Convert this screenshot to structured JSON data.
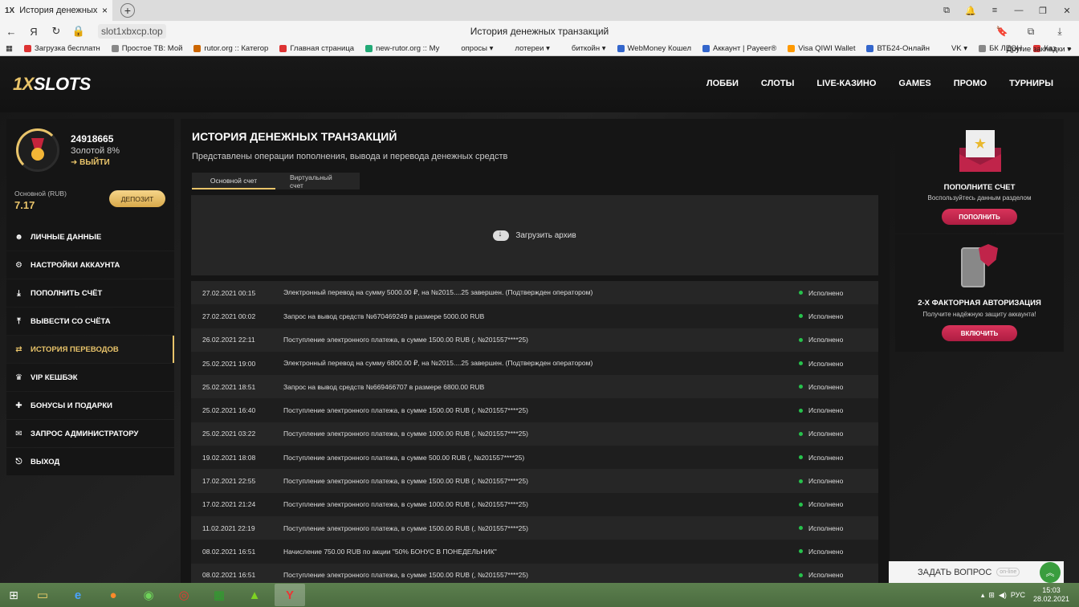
{
  "browser": {
    "tab_title": "История денежных транзакций",
    "tab_favicon": "1X",
    "tab_close": "×",
    "new_tab": "+",
    "url": "slot1xbxcp.top",
    "page_title": "История денежных транзакций",
    "bookmarks": [
      {
        "label": "Загрузка бесплатн",
        "color": "#d33"
      },
      {
        "label": "Простое ТВ: Мой",
        "color": "#888"
      },
      {
        "label": "rutor.org :: Категор",
        "color": "#c60"
      },
      {
        "label": "Главная страница",
        "color": "#d33"
      },
      {
        "label": "new-rutor.org :: Му",
        "color": "#2a7"
      },
      {
        "label": "опросы ▾",
        "color": "#f4f4f4"
      },
      {
        "label": "лотереи ▾",
        "color": "#f4f4f4"
      },
      {
        "label": "биткойн ▾",
        "color": "#f4f4f4"
      },
      {
        "label": "WebMoney Кошел",
        "color": "#36c"
      },
      {
        "label": "Аккаунт | Payeer®",
        "color": "#36c"
      },
      {
        "label": "Visa QIWI Wallet",
        "color": "#f90"
      },
      {
        "label": "ВТБ24-Онлайн",
        "color": "#36c"
      },
      {
        "label": "VK ▾",
        "color": "#f4f4f4"
      },
      {
        "label": "БК ЛЕОН",
        "color": "#888"
      },
      {
        "label": "Каз",
        "color": "#d33"
      }
    ],
    "bookmarks_more": "»",
    "other_bookmarks": "Другие закладки ▾"
  },
  "header": {
    "logo_one": "1X",
    "logo_rest": "SLOTS",
    "menu": [
      "ЛОББИ",
      "СЛОТЫ",
      "LIVE-КАЗИНО",
      "GAMES",
      "ПРОМО",
      "ТУРНИРЫ"
    ]
  },
  "profile": {
    "user_id": "24918665",
    "status": "Золотой 8%",
    "logout": "➜ ВЫЙТИ",
    "account_label": "Основной (RUB)",
    "balance": "7.17",
    "deposit_button": "ДЕПОЗИТ"
  },
  "sidebar": {
    "items": [
      {
        "label": "ЛИЧНЫЕ ДАННЫЕ",
        "icon": "user-icon",
        "glyph": "☻"
      },
      {
        "label": "НАСТРОЙКИ АККАУНТА",
        "icon": "gears-icon",
        "glyph": "⚙"
      },
      {
        "label": "ПОПОЛНИТЬ СЧЁТ",
        "icon": "download-icon",
        "glyph": "⤓"
      },
      {
        "label": "ВЫВЕСТИ СО СЧЁТА",
        "icon": "upload-icon",
        "glyph": "⤒"
      },
      {
        "label": "ИСТОРИЯ ПЕРЕВОДОВ",
        "icon": "exchange-icon",
        "glyph": "⇄"
      },
      {
        "label": "VIP КЕШБЭК",
        "icon": "crown-icon",
        "glyph": "♛"
      },
      {
        "label": "БОНУСЫ И ПОДАРКИ",
        "icon": "gift-icon",
        "glyph": "✚"
      },
      {
        "label": "ЗАПРОС АДМИНИСТРАТОРУ",
        "icon": "envelope-icon",
        "glyph": "✉"
      },
      {
        "label": "ВЫХОД",
        "icon": "logout-icon",
        "glyph": "⎋"
      }
    ],
    "active_index": 4
  },
  "main": {
    "title": "ИСТОРИЯ ДЕНЕЖНЫХ ТРАНЗАКЦИЙ",
    "subtitle": "Представлены операции пополнения, вывода и перевода денежных средств",
    "tabs": [
      "Основной счет",
      "Виртуальный счет"
    ],
    "archive_label": "Загрузить архив",
    "transactions": [
      {
        "date": "27.02.2021 00:15",
        "desc": "Электронный перевод на сумму 5000.00 ₽, на №2015....25 завершен. (Подтвержден оператором)",
        "status": "Исполнено"
      },
      {
        "date": "27.02.2021 00:02",
        "desc": "Запрос на вывод средств №670469249 в размере 5000.00 RUB",
        "status": "Исполнено"
      },
      {
        "date": "26.02.2021 22:11",
        "desc": "Поступление электронного платежа, в сумме 1500.00 RUB (, №201557****25)",
        "status": "Исполнено"
      },
      {
        "date": "25.02.2021 19:00",
        "desc": "Электронный перевод на сумму 6800.00 ₽, на №2015....25 завершен. (Подтвержден оператором)",
        "status": "Исполнено"
      },
      {
        "date": "25.02.2021 18:51",
        "desc": "Запрос на вывод средств №669466707 в размере 6800.00 RUB",
        "status": "Исполнено"
      },
      {
        "date": "25.02.2021 16:40",
        "desc": "Поступление электронного платежа, в сумме 1500.00 RUB (, №201557****25)",
        "status": "Исполнено"
      },
      {
        "date": "25.02.2021 03:22",
        "desc": "Поступление электронного платежа, в сумме 1000.00 RUB (, №201557****25)",
        "status": "Исполнено"
      },
      {
        "date": "19.02.2021 18:08",
        "desc": "Поступление электронного платежа, в сумме 500.00 RUB (, №201557****25)",
        "status": "Исполнено"
      },
      {
        "date": "17.02.2021 22:55",
        "desc": "Поступление электронного платежа, в сумме 1500.00 RUB (, №201557****25)",
        "status": "Исполнено"
      },
      {
        "date": "17.02.2021 21:24",
        "desc": "Поступление электронного платежа, в сумме 1000.00 RUB (, №201557****25)",
        "status": "Исполнено"
      },
      {
        "date": "11.02.2021 22:19",
        "desc": "Поступление электронного платежа, в сумме 1500.00 RUB (, №201557****25)",
        "status": "Исполнено"
      },
      {
        "date": "08.02.2021 16:51",
        "desc": "Начисление 750.00 RUB по акции \"50% БОНУС В ПОНЕДЕЛЬНИК\"",
        "status": "Исполнено"
      },
      {
        "date": "08.02.2021 16:51",
        "desc": "Поступление электронного платежа, в сумме 1500.00 RUB (, №201557****25)",
        "status": "Исполнено"
      }
    ]
  },
  "promo": {
    "deposit_title": "ПОПОЛНИТЕ СЧЕТ",
    "deposit_text": "Воспользуйтесь данным разделом",
    "deposit_button": "ПОПОЛНИТЬ",
    "twofa_title": "2-Х ФАКТОРНАЯ АВТОРИЗАЦИЯ",
    "twofa_text": "Получите надёжную защиту аккаунта!",
    "twofa_button": "ВКЛЮЧИТЬ"
  },
  "chat": {
    "label": "ЗАДАТЬ ВОПРОС",
    "online": "on-line"
  },
  "taskbar": {
    "lang": "РУС",
    "time": "15:03",
    "date": "28.02.2021"
  },
  "colors": {
    "accent": "#e9c46a",
    "promo_button": "#c0244a",
    "success": "#27c24c"
  }
}
